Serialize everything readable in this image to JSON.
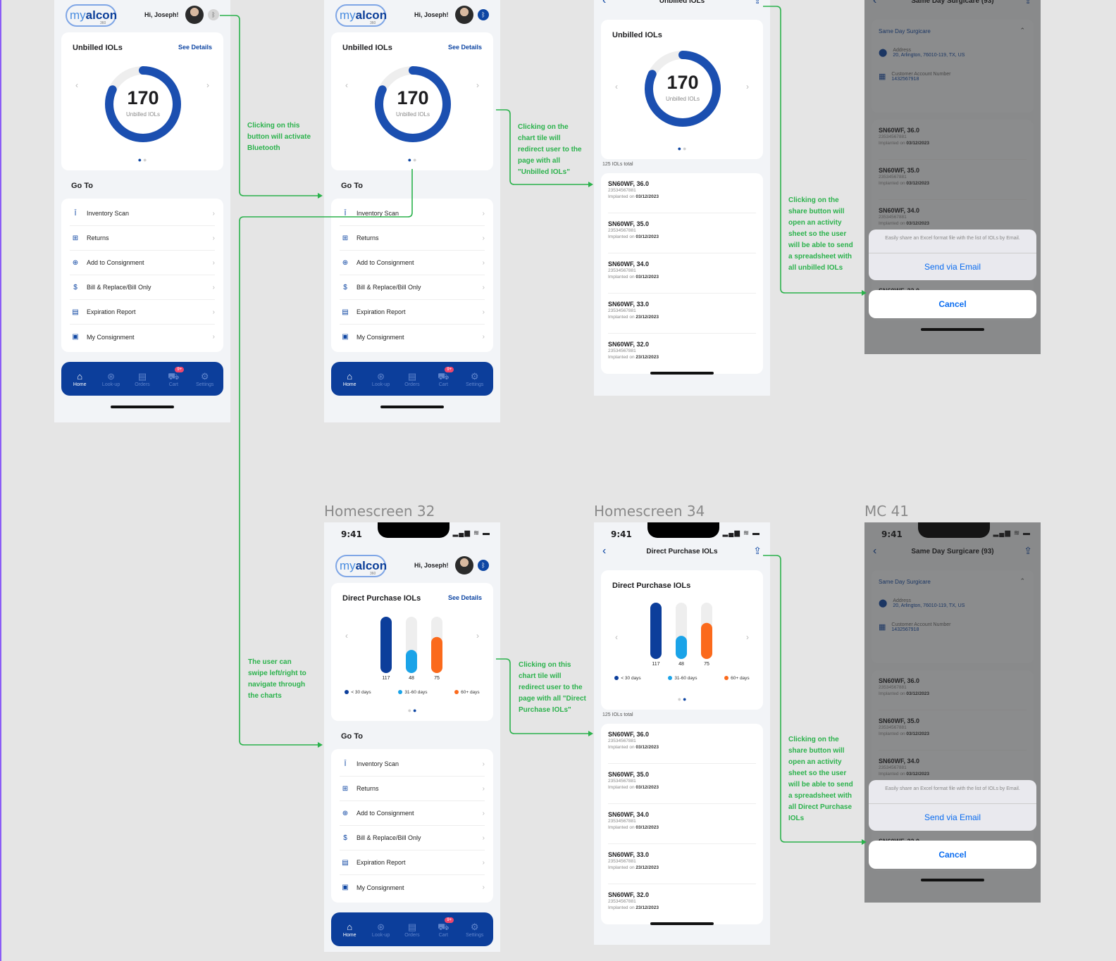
{
  "frames": {
    "homescreen32": "Homescreen 32",
    "homescreen34": "Homescreen 34",
    "mc41": "MC 41"
  },
  "status": {
    "time": "9:41",
    "icons": "▂▄▆ ≋ ▬"
  },
  "home": {
    "logo_my": "my",
    "logo_alcon": "alcon",
    "logo_sub": "360",
    "greeting": "Hi, Joseph!",
    "see_details": "See Details",
    "unbilled_title": "Unbilled IOLs",
    "unbilled_value": "170",
    "unbilled_label": "Unbilled IOLs",
    "unbilled_fraction": 0.82,
    "direct_title": "Direct Purchase IOLs",
    "goto": "Go To",
    "menu": [
      {
        "icon": "Ī",
        "label": "Inventory Scan"
      },
      {
        "icon": "⊞",
        "label": "Returns"
      },
      {
        "icon": "⊕",
        "label": "Add to Consignment"
      },
      {
        "icon": "$",
        "label": "Bill & Replace/Bill Only"
      },
      {
        "icon": "▤",
        "label": "Expiration Report"
      },
      {
        "icon": "▣",
        "label": "My Consignment"
      }
    ],
    "tabs": [
      {
        "icon": "⌂",
        "label": "Home"
      },
      {
        "icon": "⊛",
        "label": "Look-up"
      },
      {
        "icon": "▤",
        "label": "Orders"
      },
      {
        "icon": "⛟",
        "label": "Cart",
        "badge": "9+"
      },
      {
        "icon": "⚙",
        "label": "Settings"
      }
    ],
    "bluetooth_glyph": "ᛒ"
  },
  "chart_data": [
    {
      "type": "pie",
      "title": "Unbilled IOLs",
      "values": [
        170
      ],
      "label": "Unbilled IOLs"
    },
    {
      "type": "bar",
      "title": "Direct Purchase IOLs",
      "categories": [
        "< 30 days",
        "31-60 days",
        "60+ days"
      ],
      "values": [
        117,
        48,
        75
      ],
      "colors": [
        "#0c3e9b",
        "#1aa3e8",
        "#fb6a1c"
      ]
    }
  ],
  "list": {
    "unbilled_title": "Unbilled IOLs",
    "direct_title": "Direct Purchase IOLs",
    "total": "125 IOLs total",
    "items": [
      {
        "name": "SN60WF, 36.0",
        "serial": "23534567881",
        "implanted": "Implanted on",
        "date": "03/12/2023"
      },
      {
        "name": "SN60WF, 35.0",
        "serial": "23534567881",
        "implanted": "Implanted on",
        "date": "03/12/2023"
      },
      {
        "name": "SN60WF, 34.0",
        "serial": "23534567881",
        "implanted": "Implanted on",
        "date": "03/12/2023"
      },
      {
        "name": "SN60WF, 33.0",
        "serial": "23534567881",
        "implanted": "Implanted on",
        "date": "23/12/2023"
      },
      {
        "name": "SN60WF, 32.0",
        "serial": "23534567881",
        "implanted": "Implanted on",
        "date": "23/12/2023"
      }
    ]
  },
  "mc": {
    "title": "Same Day Surgicare (93)",
    "section": "Same Day Surgicare",
    "address_label": "Address",
    "address": "20, Arlington, 76010-119, TX, US",
    "account_label": "Customer Account Number",
    "account": "1432567918",
    "sheet_msg": "Easily share an Excel format file with the list of IOLs by Email.",
    "send": "Send via Email",
    "cancel": "Cancel"
  },
  "notes": {
    "bluetooth": "Clicking on this button will activate Bluetooth",
    "unbilled_tile": "Clicking on the chart tile will redirect user to the page with all \"Unbilled IOLs\"",
    "share_unbilled": "Clicking on the share button will open an activity sheet so the user will be able to send a spreadsheet with all unbilled IOLs",
    "swipe": "The user can swipe left/right to navigate through the charts",
    "direct_tile": "Clicking on this chart tile will redirect user to the page with all \"Direct Purchase IOLs\"",
    "share_direct": "Clicking on the share button will open an activity sheet so the user will be able to send a spreadsheet with all Direct Purchase IOLs"
  },
  "colors": {
    "brand": "#0c3e9b",
    "accent": "#2bb24c",
    "link": "#0a6cf0"
  }
}
